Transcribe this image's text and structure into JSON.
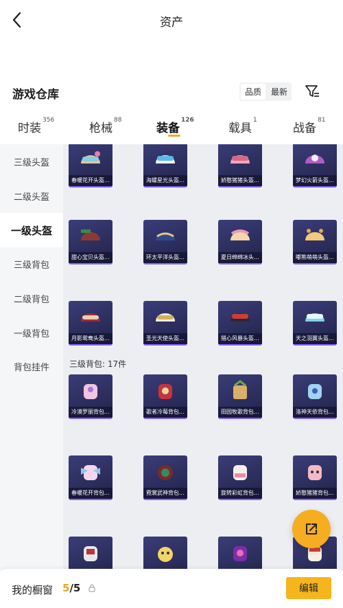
{
  "header": {
    "title": "资产"
  },
  "section": {
    "title": "游戏仓库"
  },
  "sort": {
    "quality_label": "品质",
    "latest_label": "最新"
  },
  "tabs": [
    {
      "label": "时装",
      "count": "356"
    },
    {
      "label": "枪械",
      "count": "88"
    },
    {
      "label": "装备",
      "count": "126"
    },
    {
      "label": "载具",
      "count": "1"
    },
    {
      "label": "战备",
      "count": "81"
    }
  ],
  "sidebar": [
    {
      "label": "三级头盔"
    },
    {
      "label": "二级头盔"
    },
    {
      "label": "一级头盔"
    },
    {
      "label": "三级背包"
    },
    {
      "label": "二级背包"
    },
    {
      "label": "一级背包"
    },
    {
      "label": "背包挂件"
    }
  ],
  "helmets_rows": [
    [
      "春暖花开头盔...",
      "海螺星光头盔...",
      "娇憨猪猪头盔...",
      "梦幻火箭头盔..."
    ],
    [
      "甜心宝贝头盔...",
      "环太平洋头盔...",
      "夏日绵绵冰头...",
      "嘟熊萌萌头盔..."
    ],
    [
      "月影鸳鸯头盔...",
      "圣光天使头盔...",
      "猎心风暴头盔...",
      "天之羽翼头盔..."
    ]
  ],
  "backpack_header": "三级背包: 17件",
  "backpacks_rows": [
    [
      "冷漠罗丽背包...",
      "歌者冷莓背包...",
      "田园牧歌背包...",
      "洛神天依背包..."
    ],
    [
      "春暖花开背包...",
      "霓裳武神背包...",
      "旋转彩虹背包...",
      "娇憨猪猪背包..."
    ],
    [
      "",
      "",
      "",
      ""
    ]
  ],
  "bottom": {
    "label": "我的橱窗",
    "current": "5",
    "total": "/5",
    "edit_label": "编辑"
  },
  "colors": {
    "accent": "#f6ad1f",
    "card_bg": "#2d2f5e",
    "card_border": "#8a63ff",
    "sidebar_bg": "#f5f6f8",
    "grid_bg": "#edeef2"
  }
}
